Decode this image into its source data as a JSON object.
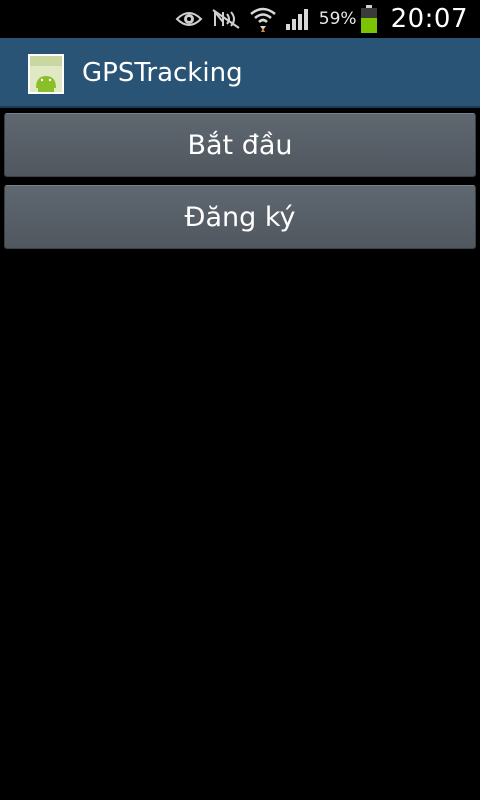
{
  "status_bar": {
    "icons": [
      "eye-icon",
      "nfc-muted-icon",
      "wifi-icon",
      "signal-icon",
      "battery-icon"
    ],
    "battery_percent": "59%",
    "time": "20:07",
    "battery_color": "#7bc400"
  },
  "action_bar": {
    "title": "GPSTracking",
    "icon": "android-app-icon",
    "background": "#2a5476"
  },
  "main": {
    "buttons": [
      {
        "label": "Bắt đầu"
      },
      {
        "label": "Đăng ký"
      }
    ]
  }
}
